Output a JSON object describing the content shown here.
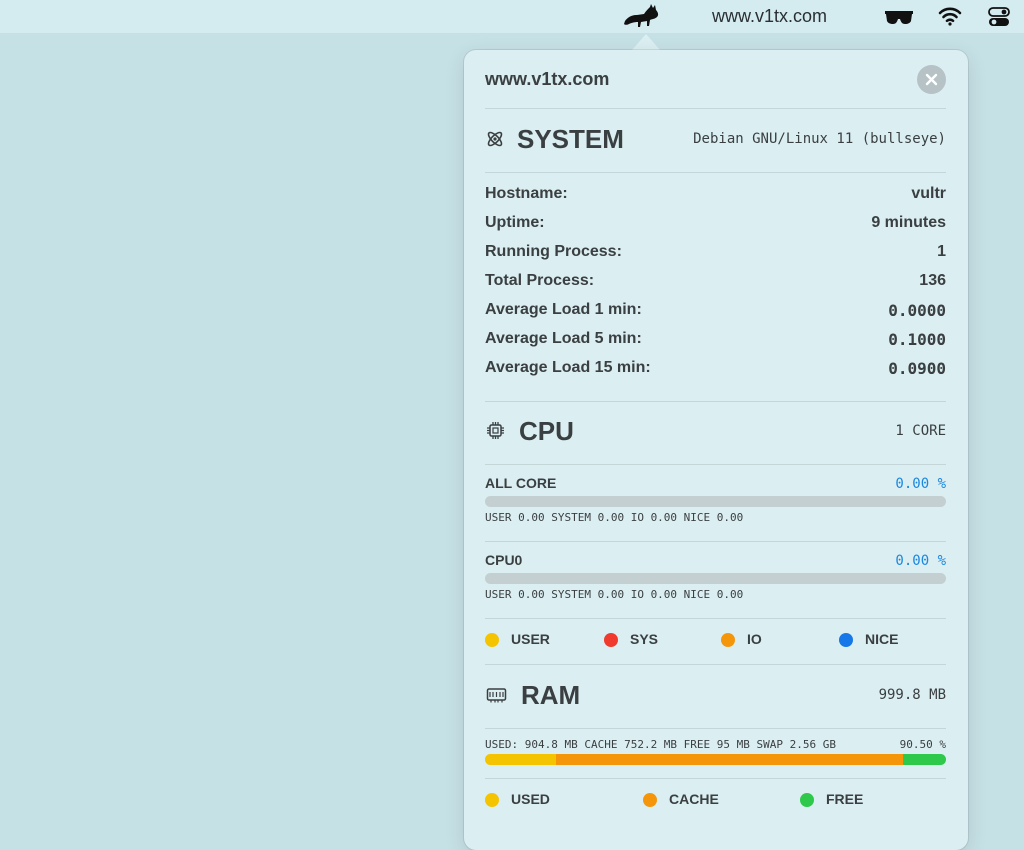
{
  "menubar": {
    "title": "www.v1tx.com",
    "icons": [
      "cat-icon",
      "glasses-icon",
      "wifi-icon",
      "control-center-icon"
    ]
  },
  "panel": {
    "title": "www.v1tx.com",
    "close_icon": "close-icon"
  },
  "system": {
    "title": "SYSTEM",
    "os": "Debian GNU/Linux 11 (bullseye)",
    "icon": "atom-icon",
    "rows": [
      {
        "label": "Hostname:",
        "value": "vultr"
      },
      {
        "label": "Uptime:",
        "value": "9 minutes"
      },
      {
        "label": "Running Process:",
        "value": "1"
      },
      {
        "label": "Total Process:",
        "value": "136"
      },
      {
        "label": "Average Load 1 min:",
        "value": "0.0000"
      },
      {
        "label": "Average Load 5 min:",
        "value": "0.1000"
      },
      {
        "label": "Average Load 15 min:",
        "value": "0.0900"
      }
    ]
  },
  "cpu": {
    "title": "CPU",
    "cores_label": "1 CORE",
    "icon": "chip-icon",
    "cores": [
      {
        "label": "ALL CORE",
        "percent": "0.00 %",
        "usage": 0,
        "detail": "USER 0.00 SYSTEM 0.00 IO 0.00 NICE 0.00"
      },
      {
        "label": "CPU0",
        "percent": "0.00 %",
        "usage": 0,
        "detail": "USER 0.00 SYSTEM 0.00 IO 0.00 NICE 0.00"
      }
    ],
    "legend": [
      {
        "label": "USER",
        "color": "#f5c400"
      },
      {
        "label": "SYS",
        "color": "#f03a2e"
      },
      {
        "label": "IO",
        "color": "#f5960a"
      },
      {
        "label": "NICE",
        "color": "#1577e8"
      }
    ]
  },
  "ram": {
    "title": "RAM",
    "total": "999.8 MB",
    "icon": "memory-icon",
    "detail": "USED: 904.8 MB CACHE 752.2 MB FREE 95 MB SWAP 2.56 GB",
    "percent": "90.50 %",
    "segments": [
      {
        "name": "used",
        "fraction": 0.155,
        "color": "#f5c400"
      },
      {
        "name": "cache",
        "fraction": 0.752,
        "color": "#f5960a"
      },
      {
        "name": "free",
        "fraction": 0.093,
        "color": "#2ec84a"
      }
    ],
    "legend": [
      {
        "label": "USED",
        "color": "#f5c400"
      },
      {
        "label": "CACHE",
        "color": "#f5960a"
      },
      {
        "label": "FREE",
        "color": "#2ec84a"
      }
    ]
  }
}
